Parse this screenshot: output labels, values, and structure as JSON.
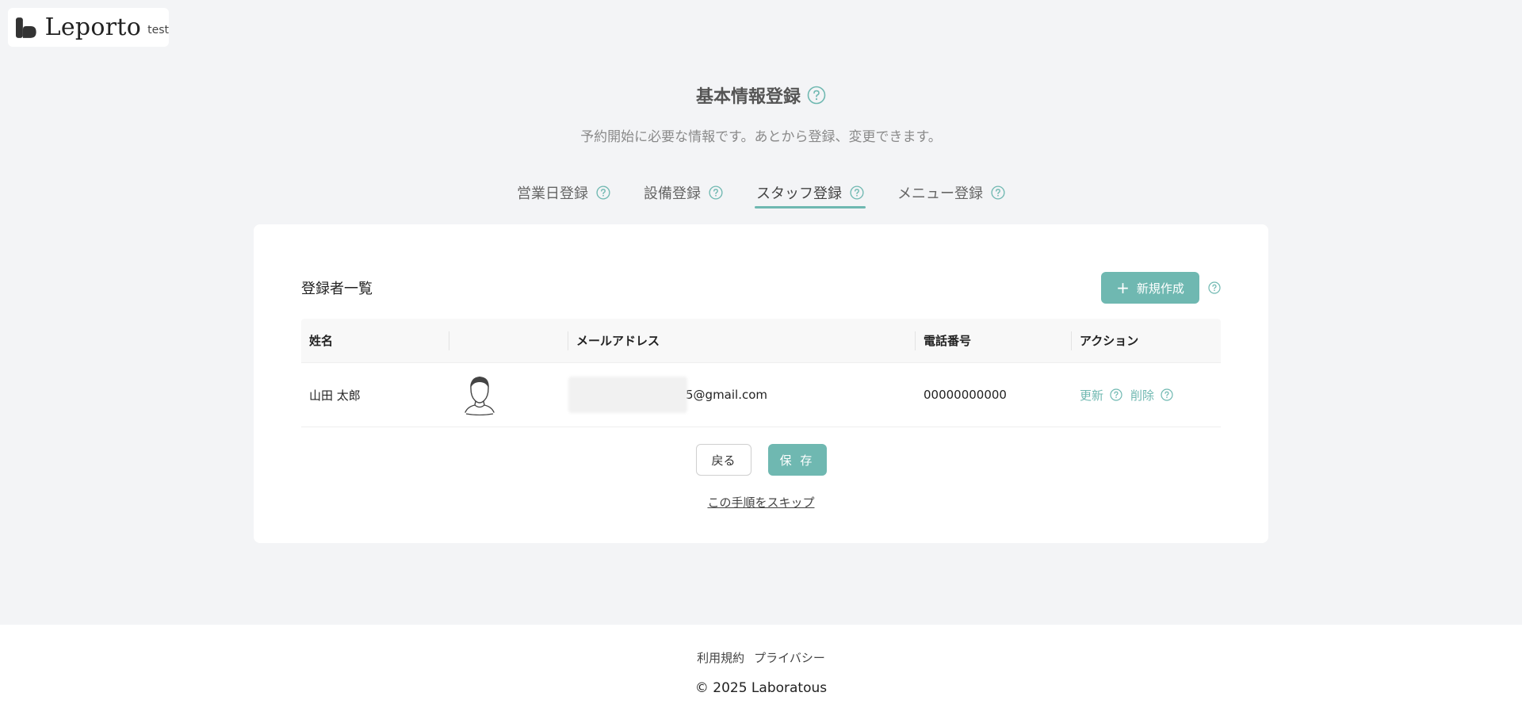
{
  "logo": {
    "wordmark": "Leporto",
    "tag": "test"
  },
  "page": {
    "title": "基本情報登録",
    "subtitle": "予約開始に必要な情報です。あとから登録、変更できます。"
  },
  "tabs": [
    {
      "label": "営業日登録",
      "active": false
    },
    {
      "label": "設備登録",
      "active": false
    },
    {
      "label": "スタッフ登録",
      "active": true
    },
    {
      "label": "メニュー登録",
      "active": false
    }
  ],
  "card": {
    "title": "登録者一覧",
    "new_button_label": "新規作成"
  },
  "table": {
    "headers": {
      "name": "姓名",
      "avatar": "",
      "email": "メールアドレス",
      "tel": "電話番号",
      "action": "アクション"
    },
    "rows": [
      {
        "name": "山田 太郎",
        "email_visible": "5@gmail.com",
        "tel": "00000000000",
        "update_label": "更新",
        "delete_label": "削除"
      }
    ]
  },
  "buttons": {
    "back_label": "戻る",
    "save_label": "保 存",
    "skip_label": "この手順をスキップ"
  },
  "footer": {
    "terms_label": "利用規約",
    "privacy_label": "プライバシー",
    "copyright": "© 2025 Laboratous"
  },
  "colors": {
    "accent": "#6fb8b1",
    "background": "#f3f4f6"
  },
  "icons": {
    "help": "question-circle-icon",
    "plus": "plus-icon",
    "avatar": "user-avatar-icon",
    "logo": "leporto-logo-mark"
  }
}
